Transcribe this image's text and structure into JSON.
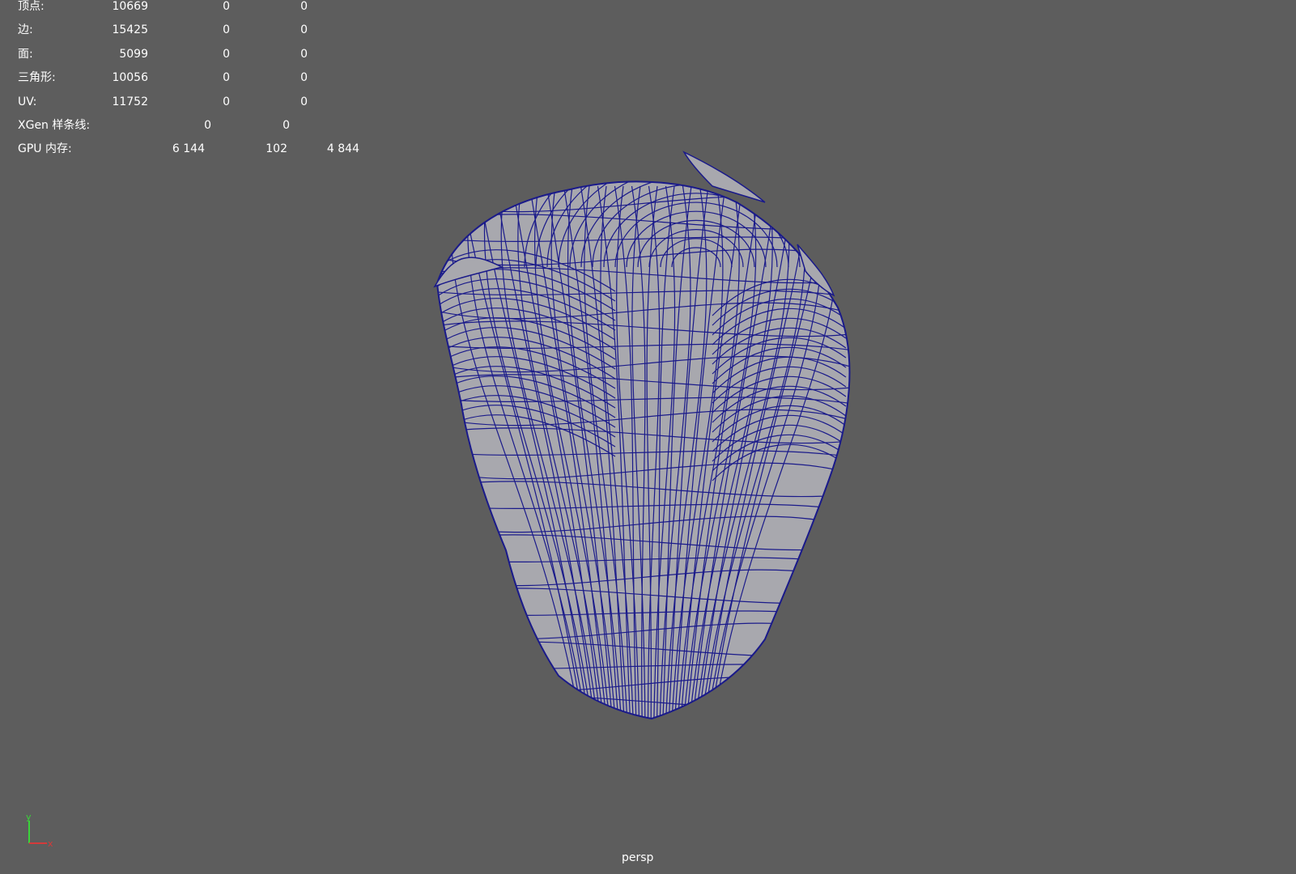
{
  "hud": {
    "rows": [
      {
        "label": "顶点:",
        "values": [
          "10669",
          "0",
          "0"
        ]
      },
      {
        "label": "边:",
        "values": [
          "15425",
          "0",
          "0"
        ]
      },
      {
        "label": "面:",
        "values": [
          "5099",
          "0",
          "0"
        ]
      },
      {
        "label": "三角形:",
        "values": [
          "10056",
          "0",
          "0"
        ]
      },
      {
        "label": "UV:",
        "values": [
          "11752",
          "0",
          "0"
        ]
      },
      {
        "label": "XGen 样条线:",
        "values": [
          "0",
          "0"
        ]
      },
      {
        "label": "GPU 内存:",
        "values": [
          "6 144",
          "102",
          "4 844"
        ]
      }
    ]
  },
  "viewport": {
    "camera_label": "persp",
    "axis": {
      "y_label": "y",
      "x_label": "x"
    }
  },
  "colors": {
    "background": "#5d5d5d",
    "wireframe": "#1a1a8a",
    "shaded": "#a8a8ae",
    "axis_x": "#d43a3a",
    "axis_y": "#3ad43a"
  }
}
